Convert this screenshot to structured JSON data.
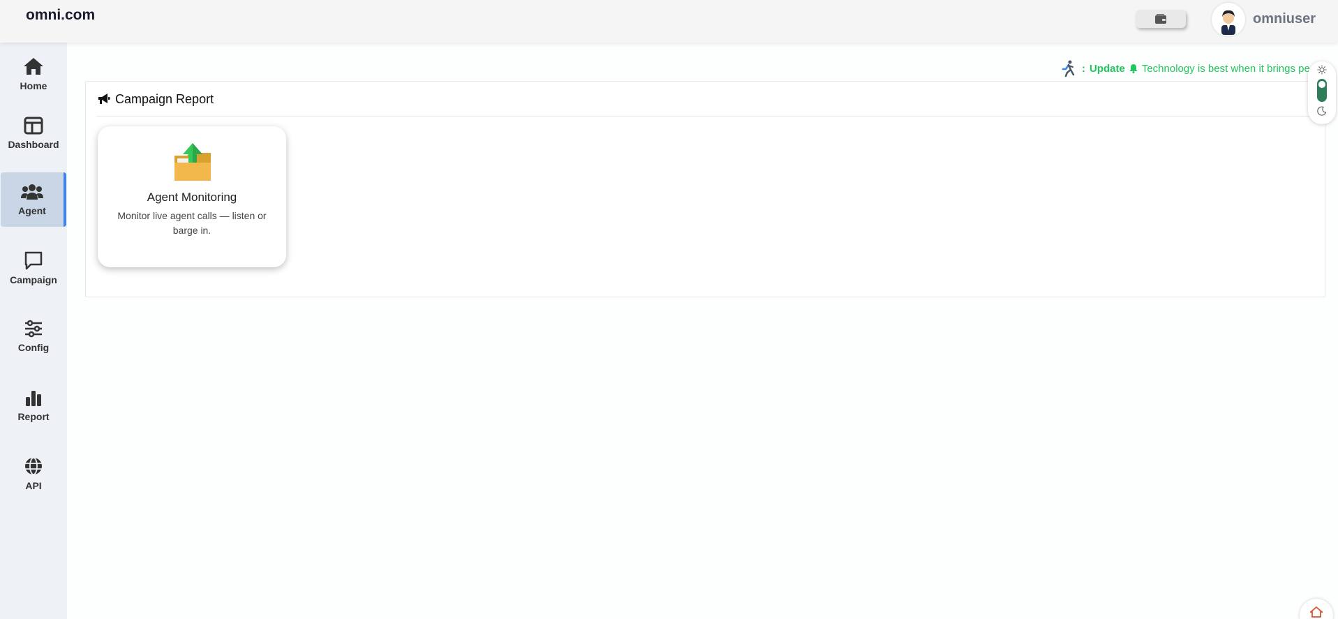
{
  "header": {
    "brand": "omni.com",
    "username": "omniuser"
  },
  "sidebar": {
    "items": [
      {
        "label": "Home",
        "icon": "home-icon"
      },
      {
        "label": "Dashboard",
        "icon": "dashboard-icon"
      },
      {
        "label": "Agent",
        "icon": "users-icon",
        "active": true
      },
      {
        "label": "Campaign",
        "icon": "chat-icon"
      },
      {
        "label": "Config",
        "icon": "sliders-icon"
      },
      {
        "label": "Report",
        "icon": "bar-chart-icon"
      },
      {
        "label": "API",
        "icon": "globe-icon"
      }
    ]
  },
  "ticker": {
    "prefix": ":",
    "label": "Update",
    "message": "Technology is best when it brings pe"
  },
  "panel": {
    "title": "Campaign Report"
  },
  "card": {
    "title": "Agent Monitoring",
    "description": "Monitor live agent calls — listen or barge in."
  },
  "colors": {
    "accent": "#22c55e",
    "active_nav": "#c9d6e5",
    "active_border": "#3b82f6",
    "toggle": "#2f7d5b"
  }
}
